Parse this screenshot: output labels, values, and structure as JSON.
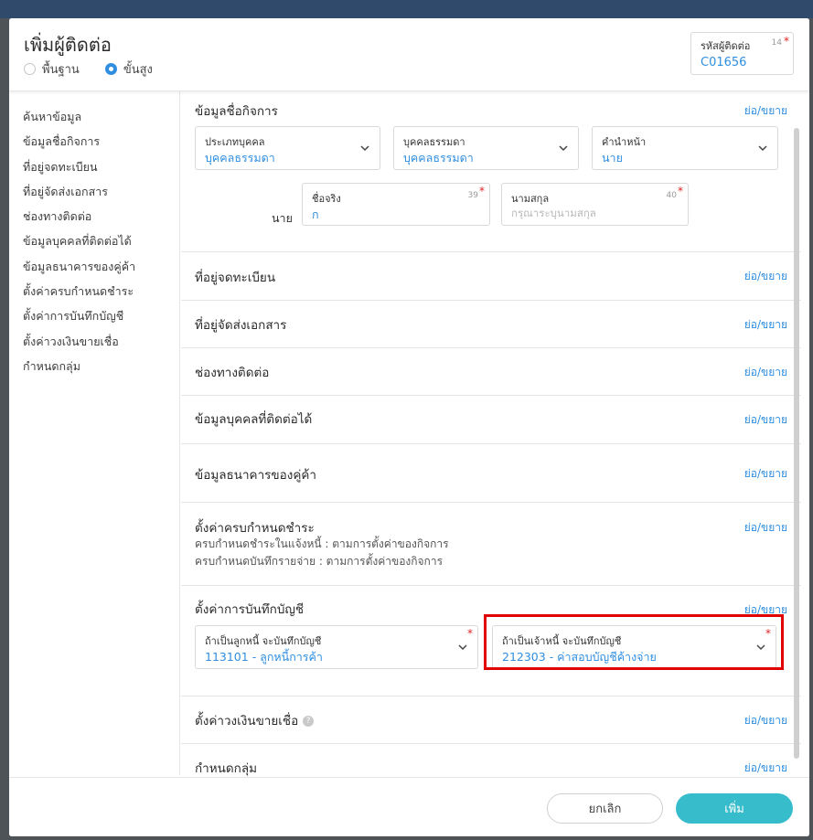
{
  "modal": {
    "title": "เพิ่มผู้ติดต่อ",
    "mode_options": [
      {
        "label": "พื้นฐาน",
        "checked": false
      },
      {
        "label": "ขั้นสูง",
        "checked": true
      }
    ],
    "contact_code": {
      "label": "รหัสผู้ติดต่อ",
      "count": "14",
      "required": "*",
      "value": "C01656"
    }
  },
  "sidebar": {
    "items": [
      {
        "label": "ค้นหาข้อมูล"
      },
      {
        "label": "ข้อมูลชื่อกิจการ"
      },
      {
        "label": "ที่อยู่จดทะเบียน"
      },
      {
        "label": "ที่อยู่จัดส่งเอกสาร"
      },
      {
        "label": "ช่องทางติดต่อ"
      },
      {
        "label": "ข้อมูลบุคคลที่ติดต่อได้"
      },
      {
        "label": "ข้อมูลธนาคารของคู่ค้า"
      },
      {
        "label": "ตั้งค่าครบกำหนดชำระ"
      },
      {
        "label": "ตั้งค่าการบันทึกบัญชี"
      },
      {
        "label": "ตั้งค่าวงเงินขายเชื่อ"
      },
      {
        "label": "กำหนดกลุ่ม"
      }
    ]
  },
  "toggle_label": "ย่อ/ขยาย",
  "business_info": {
    "title": "ข้อมูลชื่อกิจการ",
    "person_type": {
      "label": "ประเภทบุคคล",
      "value": "บุคคลธรรมดา"
    },
    "person_kind": {
      "label": "บุคคลธรรมดา",
      "value": "บุคคลธรรมดา"
    },
    "prefix": {
      "label": "คำนำหน้า",
      "value": "นาย"
    },
    "prefix_text": "นาย",
    "first_name": {
      "label": "ชื่อจริง",
      "count": "39",
      "required": "*",
      "value": "ก"
    },
    "last_name": {
      "label": "นามสกุล",
      "count": "40",
      "required": "*",
      "placeholder": "กรุณาระบุนามสกุล"
    }
  },
  "sections": {
    "registered_address": "ที่อยู่จดทะเบียน",
    "shipping_address": "ที่อยู่จัดส่งเอกสาร",
    "contact_channel": "ช่องทางติดต่อ",
    "contact_persons": "ข้อมูลบุคคลที่ติดต่อได้",
    "bank_info": "ข้อมูลธนาคารของคู่ค้า",
    "credit_limit": "ตั้งค่าวงเงินขายเชื่อ",
    "groups": "กำหนดกลุ่ม"
  },
  "payment_terms": {
    "title": "ตั้งค่าครบกำหนดชำระ",
    "line1": "ครบกำหนดชำระในแจ้งหนี้ : ตามการตั้งค่าของกิจการ",
    "line2": "ครบกำหนดบันทึกรายจ่าย : ตามการตั้งค่าของกิจการ"
  },
  "accounting": {
    "title": "ตั้งค่าการบันทึกบัญชี",
    "receivable": {
      "label": "ถ้าเป็นลูกหนี้ จะบันทึกบัญชี",
      "required": "*",
      "value": "113101 - ลูกหนี้การค้า"
    },
    "payable": {
      "label": "ถ้าเป็นเจ้าหนี้ จะบันทึกบัญชี",
      "required": "*",
      "value": "212303 - ค่าสอบบัญชีค้างจ่าย"
    }
  },
  "footer": {
    "cancel_label": "ยกเลิก",
    "add_label": "เพิ่ม"
  },
  "colors": {
    "accent": "#2f8ee0",
    "primary_button": "#36bccb",
    "required": "#e02424",
    "highlight": "#e00000"
  }
}
